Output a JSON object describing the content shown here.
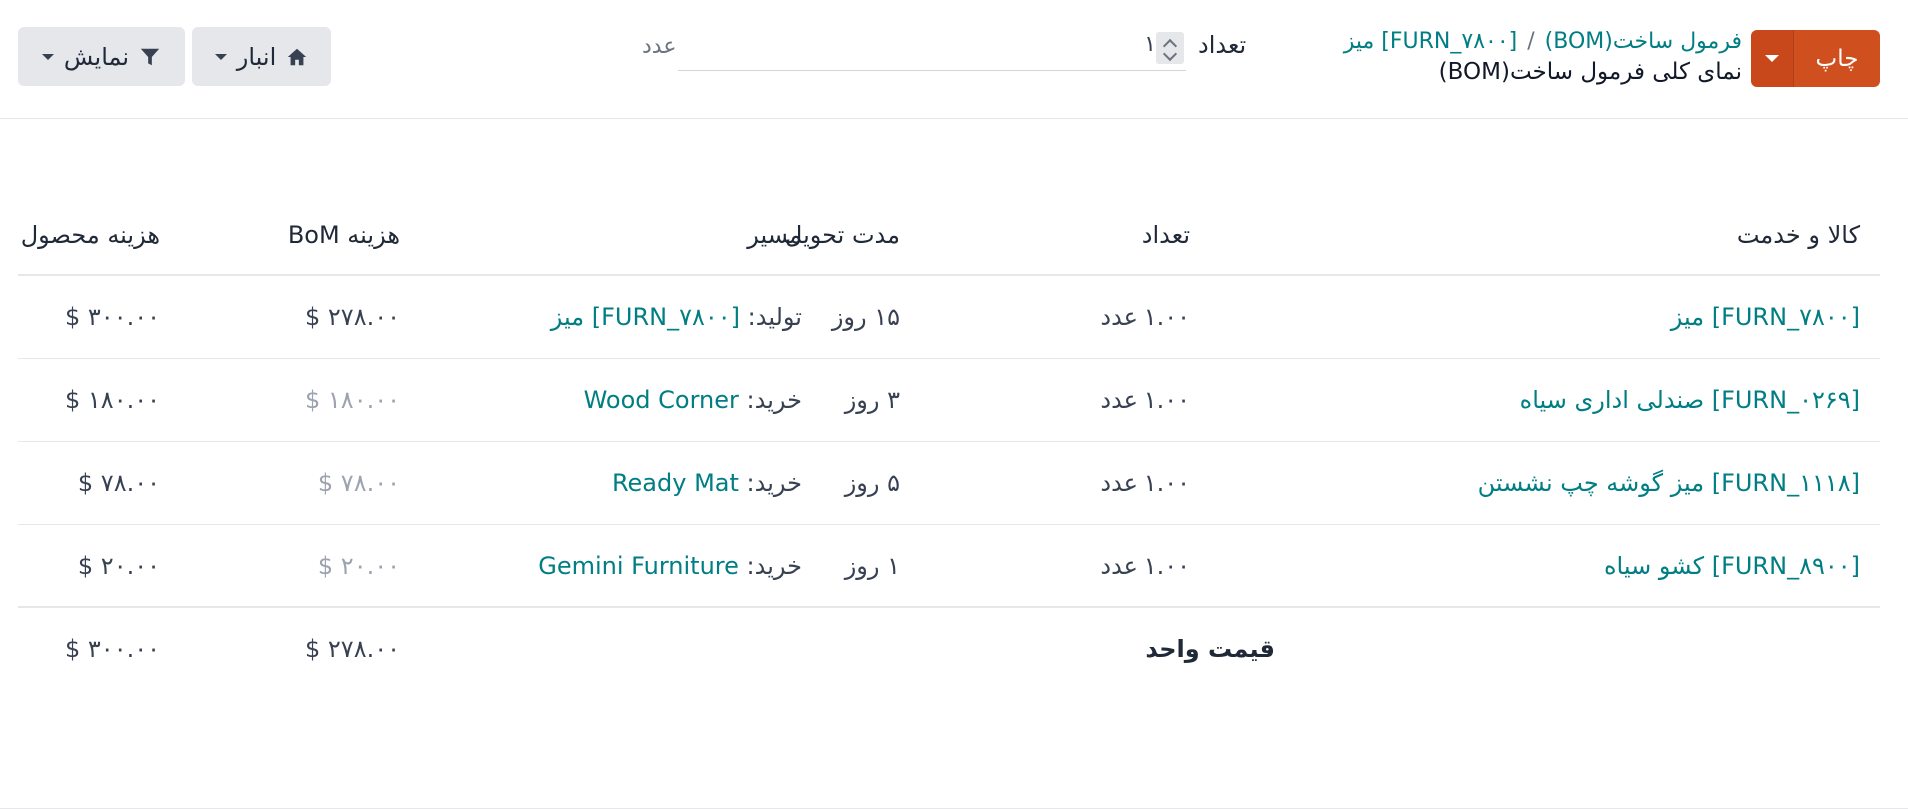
{
  "header": {
    "print_label": "چاپ",
    "breadcrumb_parent": "فرمول ساخت(BOM)",
    "breadcrumb_item": "[FURN_۷۸۰۰] میز",
    "breadcrumb_separator": "/",
    "page_title": "نمای کلی فرمول ساخت(BOM)",
    "qty_label": "تعداد",
    "qty_value": "۱",
    "qty_unit": "عدد",
    "warehouse_label": "انبار",
    "display_label": "نمایش"
  },
  "table": {
    "headers": {
      "product": "کالا و خدمت",
      "quantity": "تعداد",
      "lead_time": "مدت تحویل",
      "route": "مسیر",
      "bom_cost": "هزینه BoM",
      "product_cost": "هزینه محصول"
    },
    "rows": [
      {
        "product": "[FURN_۷۸۰۰] میز",
        "quantity": "۱.۰۰",
        "uom": "عدد",
        "lead_time": "۱۵ روز",
        "route_prefix": "تولید:",
        "route_value": "[FURN_۷۸۰۰] میز",
        "bom_cost": "۲۷۸.۰۰ $",
        "product_cost": "۳۰۰.۰۰ $"
      },
      {
        "product": "[FURN_۰۲۶۹] صندلی اداری سیاه",
        "quantity": "۱.۰۰",
        "uom": "عدد",
        "lead_time": "۳ روز",
        "route_prefix": "خرید:",
        "route_value": "Wood Corner",
        "bom_cost": "۱۸۰.۰۰ $",
        "product_cost": "۱۸۰.۰۰ $"
      },
      {
        "product": "[FURN_۱۱۱۸] میز گوشه چپ نشستن",
        "quantity": "۱.۰۰",
        "uom": "عدد",
        "lead_time": "۵ روز",
        "route_prefix": "خرید:",
        "route_value": "Ready Mat",
        "bom_cost": "۷۸.۰۰ $",
        "product_cost": "۷۸.۰۰ $"
      },
      {
        "product": "[FURN_۸۹۰۰] کشو سیاه",
        "quantity": "۱.۰۰",
        "uom": "عدد",
        "lead_time": "۱ روز",
        "route_prefix": "خرید:",
        "route_value": "Gemini Furniture",
        "bom_cost": "۲۰.۰۰ $",
        "product_cost": "۲۰.۰۰ $"
      }
    ],
    "footer": {
      "label": "قیمت واحد",
      "bom_cost": "۲۷۸.۰۰ $",
      "product_cost": "۳۰۰.۰۰ $"
    }
  },
  "colors": {
    "accent": "#d04f1f",
    "link": "#017e84"
  },
  "icons": {
    "print_dropdown": "caret-down-icon",
    "warehouse": "home-icon",
    "display": "filter-icon"
  }
}
